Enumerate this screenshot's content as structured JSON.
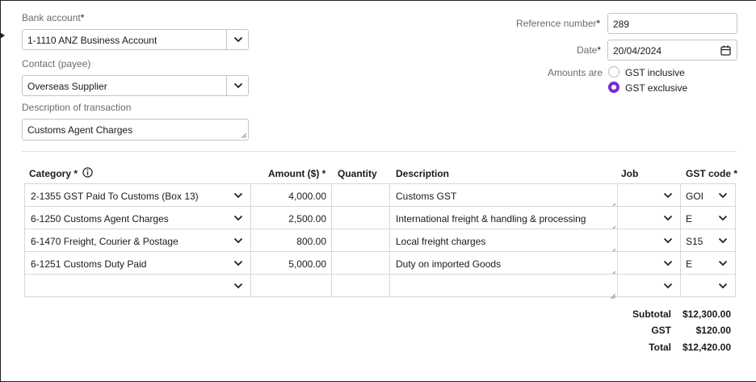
{
  "form": {
    "bank_account": {
      "label": "Bank account",
      "required": "*",
      "value": "1-1110  ANZ Business Account"
    },
    "contact": {
      "label": "Contact (payee)",
      "value": "Overseas Supplier"
    },
    "description": {
      "label": "Description of transaction",
      "value": "Customs Agent Charges"
    },
    "reference": {
      "label": "Reference number",
      "required": "*",
      "value": "289"
    },
    "date": {
      "label": "Date",
      "required": "*",
      "value": "20/04/2024"
    },
    "amounts_are": {
      "label": "Amounts are",
      "options": [
        {
          "label": "GST inclusive",
          "selected": false
        },
        {
          "label": "GST exclusive",
          "selected": true
        }
      ]
    }
  },
  "table": {
    "headers": {
      "category": "Category *",
      "amount": "Amount ($) *",
      "quantity": "Quantity",
      "description": "Description",
      "job": "Job",
      "gst_code": "GST code *"
    },
    "rows": [
      {
        "category": "2-1355  GST Paid To Customs (Box 13)",
        "amount": "4,000.00",
        "quantity": "",
        "description": "Customs GST",
        "job": "",
        "gst_code": "GOI"
      },
      {
        "category": "6-1250  Customs Agent Charges",
        "amount": "2,500.00",
        "quantity": "",
        "description": "International freight & handling & processing",
        "job": "",
        "gst_code": "E"
      },
      {
        "category": "6-1470  Freight, Courier & Postage",
        "amount": "800.00",
        "quantity": "",
        "description": "Local freight charges",
        "job": "",
        "gst_code": "S15"
      },
      {
        "category": "6-1251  Customs Duty Paid",
        "amount": "5,000.00",
        "quantity": "",
        "description": "Duty on imported Goods",
        "job": "",
        "gst_code": "E"
      },
      {
        "category": "",
        "amount": "",
        "quantity": "",
        "description": "",
        "job": "",
        "gst_code": ""
      }
    ]
  },
  "totals": {
    "subtotal_label": "Subtotal",
    "subtotal": "$12,300.00",
    "gst_label": "GST",
    "gst": "$120.00",
    "total_label": "Total",
    "total": "$12,420.00"
  },
  "colors": {
    "accent": "#7a2ed0",
    "border": "#c5c5c5",
    "label": "#6b6b6b"
  },
  "icons": [
    "chevron-down-icon",
    "calendar-icon",
    "info-icon",
    "resize-handle-icon"
  ]
}
